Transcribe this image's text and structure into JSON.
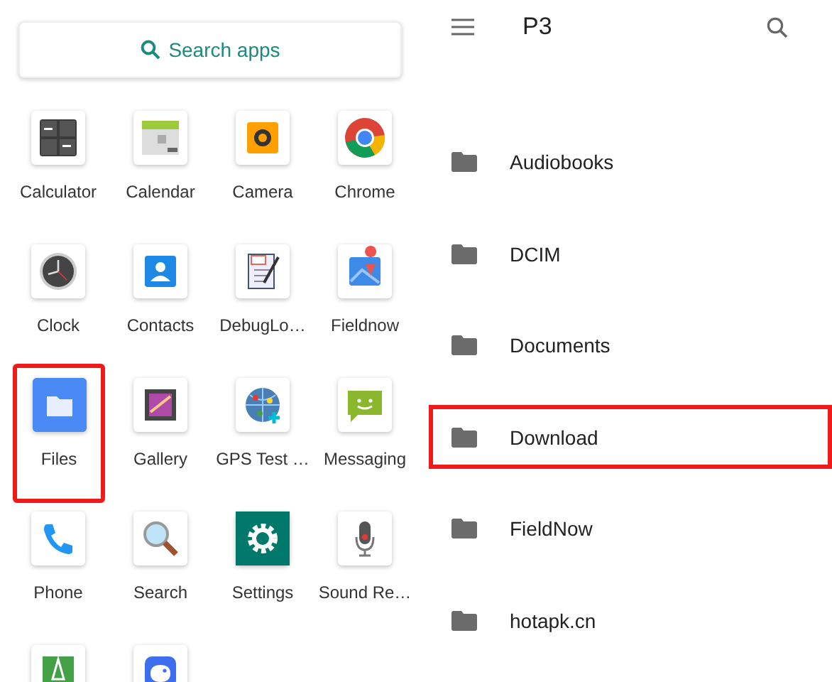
{
  "launcher": {
    "search": {
      "placeholder": "Search apps"
    },
    "apps": [
      {
        "label": "Calculator",
        "highlighted": false
      },
      {
        "label": "Calendar",
        "highlighted": false
      },
      {
        "label": "Camera",
        "highlighted": false
      },
      {
        "label": "Chrome",
        "highlighted": false
      },
      {
        "label": "Clock",
        "highlighted": false
      },
      {
        "label": "Contacts",
        "highlighted": false
      },
      {
        "label": "DebugLo…",
        "highlighted": false
      },
      {
        "label": "Fieldnow",
        "highlighted": false
      },
      {
        "label": "Files",
        "highlighted": true
      },
      {
        "label": "Gallery",
        "highlighted": false
      },
      {
        "label": "GPS Test …",
        "highlighted": false
      },
      {
        "label": "Messaging",
        "highlighted": false
      },
      {
        "label": "Phone",
        "highlighted": false
      },
      {
        "label": "Search",
        "highlighted": false
      },
      {
        "label": "Settings",
        "highlighted": false
      },
      {
        "label": "Sound Re…",
        "highlighted": false
      },
      {
        "highlighted": false
      },
      {
        "highlighted": false
      }
    ]
  },
  "files": {
    "toolbar": {
      "title": "P3"
    },
    "folders": [
      {
        "name": "Audiobooks",
        "highlighted": false
      },
      {
        "name": "DCIM",
        "highlighted": false
      },
      {
        "name": "Documents",
        "highlighted": false
      },
      {
        "name": "Download",
        "highlighted": true
      },
      {
        "name": "FieldNow",
        "highlighted": false
      },
      {
        "name": "hotapk.cn",
        "highlighted": false
      }
    ]
  }
}
